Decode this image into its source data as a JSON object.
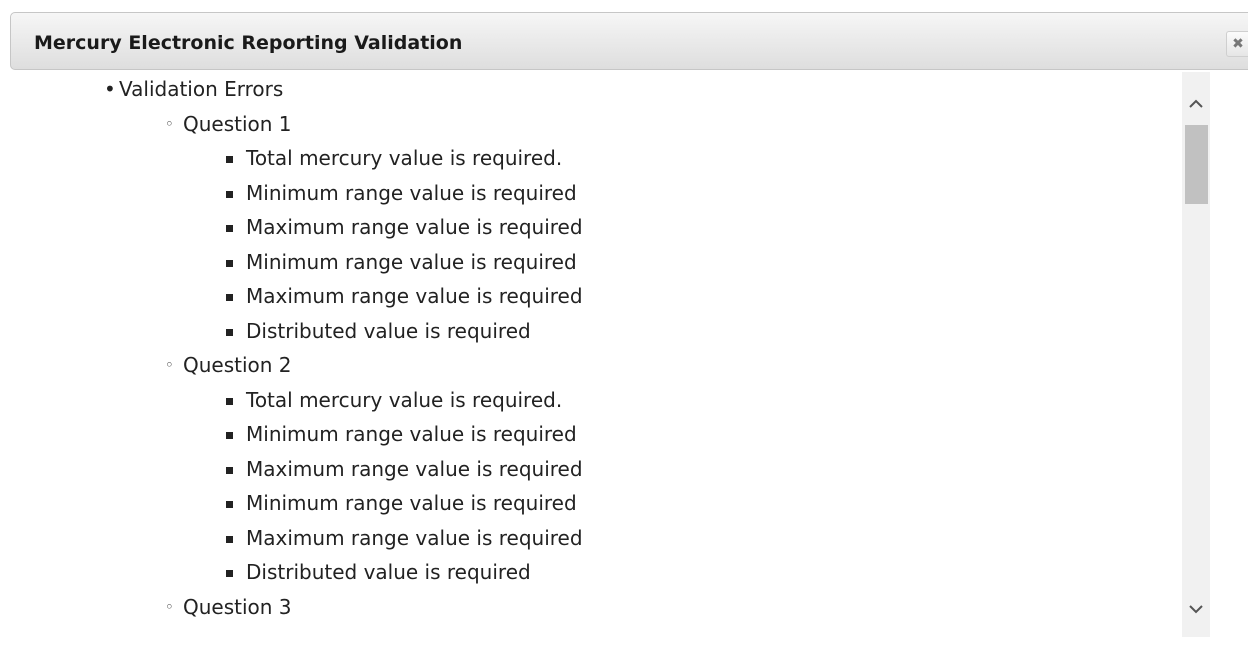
{
  "dialog": {
    "title": "Mercury Electronic Reporting Validation",
    "close_icon": "close-icon"
  },
  "content": {
    "heading": "Validation Errors",
    "questions": [
      {
        "label": "Question 1",
        "errors": [
          "Total mercury value is required.",
          "Minimum range value is required",
          "Maximum range value is required",
          "Minimum range value is required",
          "Maximum range value is required",
          "Distributed value is required"
        ]
      },
      {
        "label": "Question 2",
        "errors": [
          "Total mercury value is required.",
          "Minimum range value is required",
          "Maximum range value is required",
          "Minimum range value is required",
          "Maximum range value is required",
          "Distributed value is required"
        ]
      },
      {
        "label": "Question 3",
        "errors": []
      }
    ]
  },
  "scrollbar": {
    "up_icon": "chevron-up-icon",
    "down_icon": "chevron-down-icon",
    "position_fraction": 0.08
  }
}
